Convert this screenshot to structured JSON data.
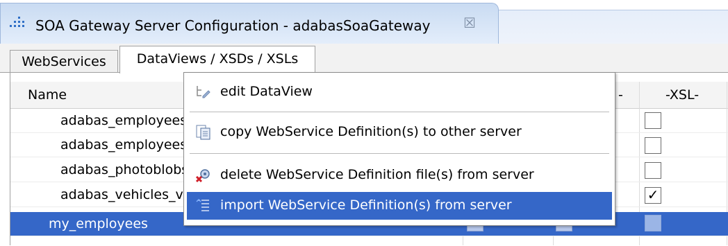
{
  "editor": {
    "title": "SOA Gateway Server Configuration - adabasSoaGateway",
    "icon": "dotted-grid-icon",
    "close_glyph": "☒"
  },
  "tabs": [
    {
      "label": "WebServices",
      "active": false
    },
    {
      "label": "DataViews / XSDs / XSLs",
      "active": true
    }
  ],
  "table": {
    "columns": {
      "name": "Name",
      "partial": "-",
      "xsl": "-XSL-"
    },
    "rows": [
      {
        "name": "adabas_employees",
        "xsl_checked": false,
        "selected": false
      },
      {
        "name": "adabas_employees",
        "xsl_checked": false,
        "selected": false
      },
      {
        "name": "adabas_photoblobs",
        "xsl_checked": false,
        "selected": false
      },
      {
        "name": "adabas_vehicles_v",
        "xsl_checked": true,
        "selected": false
      },
      {
        "name": "my_employees",
        "xsl_checked": false,
        "selected": true
      }
    ],
    "check_glyph": "✓"
  },
  "context_menu": {
    "items": [
      {
        "label": "edit DataView",
        "icon": "tree-pencil-icon",
        "highlighted": false
      },
      {
        "label": "copy WebService Definition(s) to other server",
        "icon": "document-copy-icon",
        "highlighted": false
      },
      {
        "label": "delete WebService Definition file(s) from server",
        "icon": "delete-gear-icon",
        "highlighted": false
      },
      {
        "label": "import WebService Definition(s) from server",
        "icon": "import-list-icon",
        "highlighted": true
      }
    ]
  },
  "colors": {
    "selection": "#3567c8",
    "tab_gradient_top": "#c9dbf2"
  }
}
